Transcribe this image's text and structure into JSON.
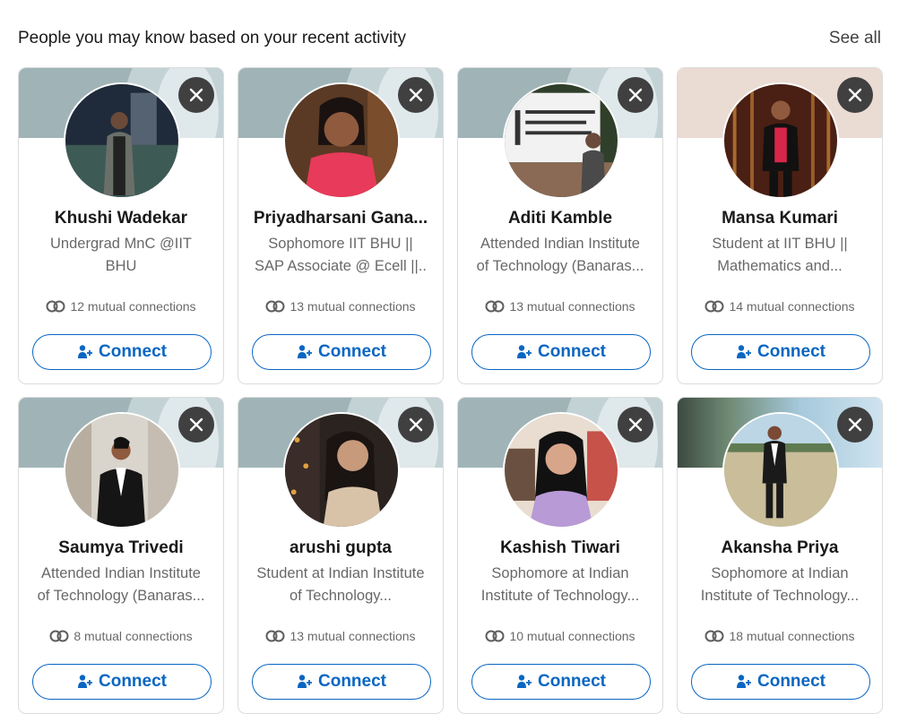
{
  "header": {
    "title": "People you may know based on your recent activity",
    "see_all": "See all"
  },
  "colors": {
    "accent": "#0a66c2",
    "dismiss_bg": "#404040",
    "banner": "#a0b4b7"
  },
  "icons": {
    "dismiss": "close-icon",
    "mutual": "mutual-connections-icon",
    "connect": "add-person-icon"
  },
  "cards": [
    {
      "name": "Khushi Wadekar",
      "headline": "Undergrad MnC @IIT BHU",
      "mutual": "12 mutual connections",
      "connect": "Connect"
    },
    {
      "name": "Priyadharsani Gana...",
      "headline": "Sophomore IIT BHU || SAP Associate @ Ecell ||..",
      "mutual": "13 mutual connections",
      "connect": "Connect"
    },
    {
      "name": "Aditi Kamble",
      "headline": "Attended Indian Institute of Technology (Banaras...",
      "mutual": "13 mutual connections",
      "connect": "Connect"
    },
    {
      "name": "Mansa Kumari",
      "headline": "Student at IIT BHU || Mathematics and...",
      "mutual": "14 mutual connections",
      "connect": "Connect"
    },
    {
      "name": "Saumya Trivedi",
      "headline": "Attended Indian Institute of Technology (Banaras...",
      "mutual": "8 mutual connections",
      "connect": "Connect"
    },
    {
      "name": "arushi gupta",
      "headline": "Student at Indian Institute of Technology...",
      "mutual": "13 mutual connections",
      "connect": "Connect"
    },
    {
      "name": "Kashish Tiwari",
      "headline": "Sophomore at Indian Institute of Technology...",
      "mutual": "10 mutual connections",
      "connect": "Connect"
    },
    {
      "name": "Akansha Priya",
      "headline": "Sophomore at Indian Institute of Technology...",
      "mutual": "18 mutual connections",
      "connect": "Connect"
    }
  ]
}
